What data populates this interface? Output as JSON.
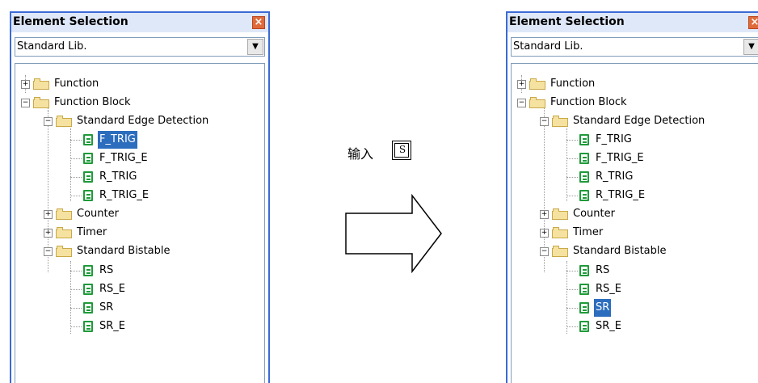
{
  "left_panel": {
    "title": "Element Selection",
    "library": "Standard Lib.",
    "tree": {
      "function": "Function",
      "function_block": "Function Block",
      "edge_detection": "Standard Edge Detection",
      "f_trig": "F_TRIG",
      "f_trig_e": "F_TRIG_E",
      "r_trig": "R_TRIG",
      "r_trig_e": "R_TRIG_E",
      "counter": "Counter",
      "timer": "Timer",
      "bistable": "Standard Bistable",
      "rs": "RS",
      "rs_e": "RS_E",
      "sr": "SR",
      "sr_e": "SR_E"
    },
    "selected": "F_TRIG"
  },
  "right_panel": {
    "title": "Element Selection",
    "library": "Standard Lib.",
    "tree": {
      "function": "Function",
      "function_block": "Function Block",
      "edge_detection": "Standard Edge Detection",
      "f_trig": "F_TRIG",
      "f_trig_e": "F_TRIG_E",
      "r_trig": "R_TRIG",
      "r_trig_e": "R_TRIG_E",
      "counter": "Counter",
      "timer": "Timer",
      "bistable": "Standard Bistable",
      "rs": "RS",
      "rs_e": "RS_E",
      "sr": "SR",
      "sr_e": "SR_E"
    },
    "selected": "SR"
  },
  "instruction": {
    "text": "输入",
    "key": "S"
  },
  "colors": {
    "selection": "#2c6dbd",
    "frame": "#3a6ad6",
    "doc_icon": "#1f9a3a"
  }
}
